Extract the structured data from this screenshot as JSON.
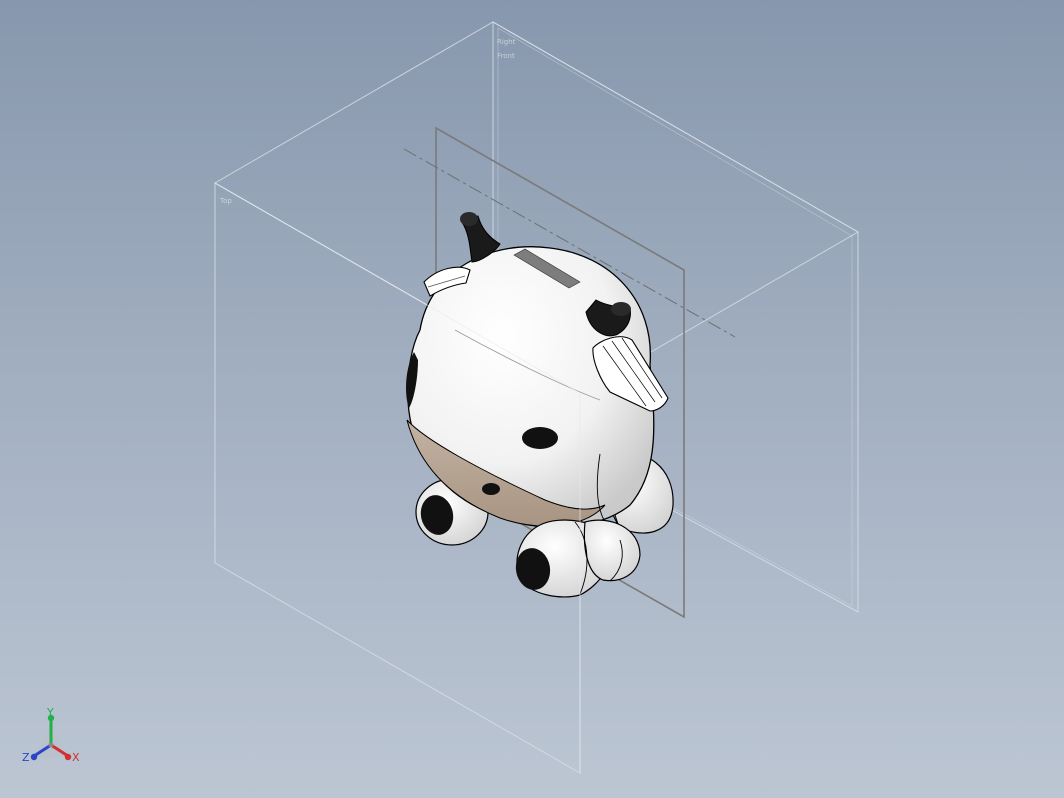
{
  "viewport": {
    "background_top": "#8797ad",
    "background_bottom": "#bcc6d3"
  },
  "reference_planes": [
    {
      "name": "front-plane",
      "label": "Front"
    },
    {
      "name": "right-plane",
      "label": "Right"
    },
    {
      "name": "top-plane",
      "label": "Top"
    }
  ],
  "model": {
    "colors": {
      "body": "#ffffff",
      "spots": "#111111",
      "muzzle": "#b6a493",
      "outline": "#000000"
    }
  },
  "triad": {
    "x_label": "X",
    "y_label": "Y",
    "z_label": "Z",
    "x_color": "#d23030",
    "y_color": "#22b04a",
    "z_color": "#2c44c8"
  }
}
